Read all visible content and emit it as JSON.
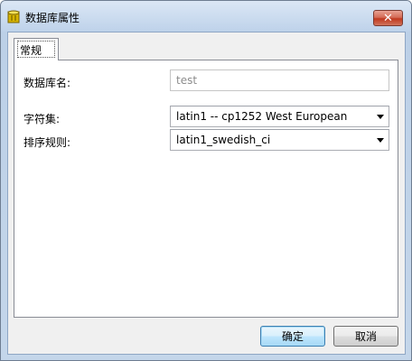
{
  "window": {
    "title": "数据库属性",
    "close_label": "✕"
  },
  "tabs": [
    {
      "label": "常规",
      "active": true
    }
  ],
  "form": {
    "db_name_label": "数据库名:",
    "db_name_value": "test",
    "charset_label": "字符集:",
    "charset_value": "latin1 -- cp1252 West European",
    "collation_label": "排序规则:",
    "collation_value": "latin1_swedish_ci"
  },
  "buttons": {
    "ok": "确定",
    "cancel": "取消"
  },
  "colors": {
    "title_accent": "#c4d6ea",
    "close_button": "#c0391f",
    "default_button": "#3c7fb1"
  },
  "icons": {
    "app": "database-icon",
    "close": "close-icon",
    "dropdown": "chevron-down-icon"
  }
}
